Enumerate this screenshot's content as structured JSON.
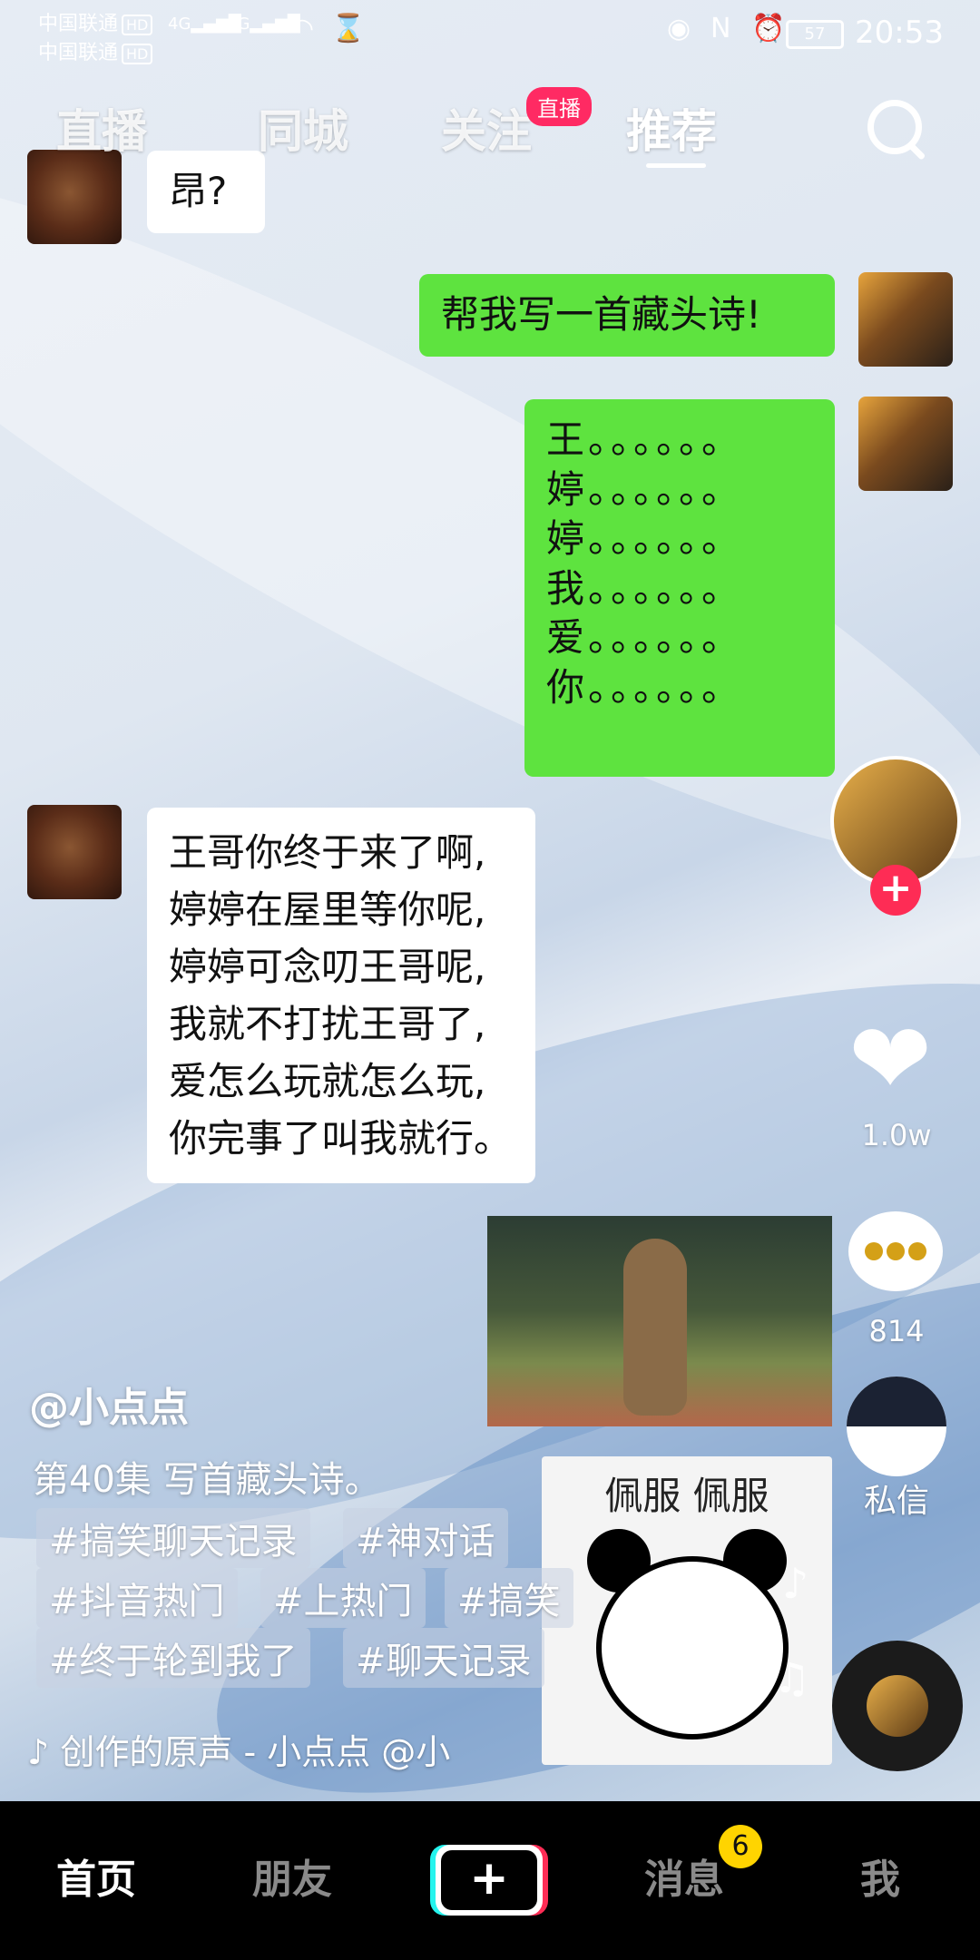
{
  "status_bar": {
    "carrier1": "中国联通",
    "carrier2": "中国联通",
    "hd": "HD",
    "network": "4G",
    "battery": "57",
    "time": "20:53"
  },
  "top_tabs": [
    {
      "label": "直播"
    },
    {
      "label": "同城"
    },
    {
      "label": "关注"
    },
    {
      "label": "推荐"
    }
  ],
  "follow_live_badge": "直播",
  "chat": {
    "msg1": "昂?",
    "msg2": "帮我写一首藏头诗!",
    "poem": [
      "王。。。。。。",
      "婷。。。。。。",
      "婷。。。。。。",
      "我。。。。。。",
      "爱。。。。。。",
      "你。。。。。。"
    ],
    "reply": [
      "王哥你终于来了啊,",
      "婷婷在屋里等你呢,",
      "婷婷可念叨王哥呢,",
      "我就不打扰王哥了,",
      "爱怎么玩就怎么玩,",
      "你完事了叫我就行。"
    ],
    "meme_text": "佩服  佩服"
  },
  "rail": {
    "likes": "1.0w",
    "comments": "814",
    "dm_label": "私信"
  },
  "caption": {
    "author": "@小点点",
    "description": "第40集 写首藏头诗。",
    "tags": [
      "#搞笑聊天记录",
      "#神对话",
      "#抖音热门",
      "#上热门",
      "#搞笑",
      "#终于轮到我了",
      "#聊天记录"
    ],
    "music": "创作的原声 - 小点点   @小"
  },
  "nav": {
    "home": "首页",
    "friends": "朋友",
    "plus": "+",
    "messages": "消息",
    "messages_badge": "6",
    "me": "我"
  },
  "colors": {
    "accent_red": "#fe2c55",
    "chat_green": "#5ee33f",
    "badge_yellow": "#ffd400"
  }
}
